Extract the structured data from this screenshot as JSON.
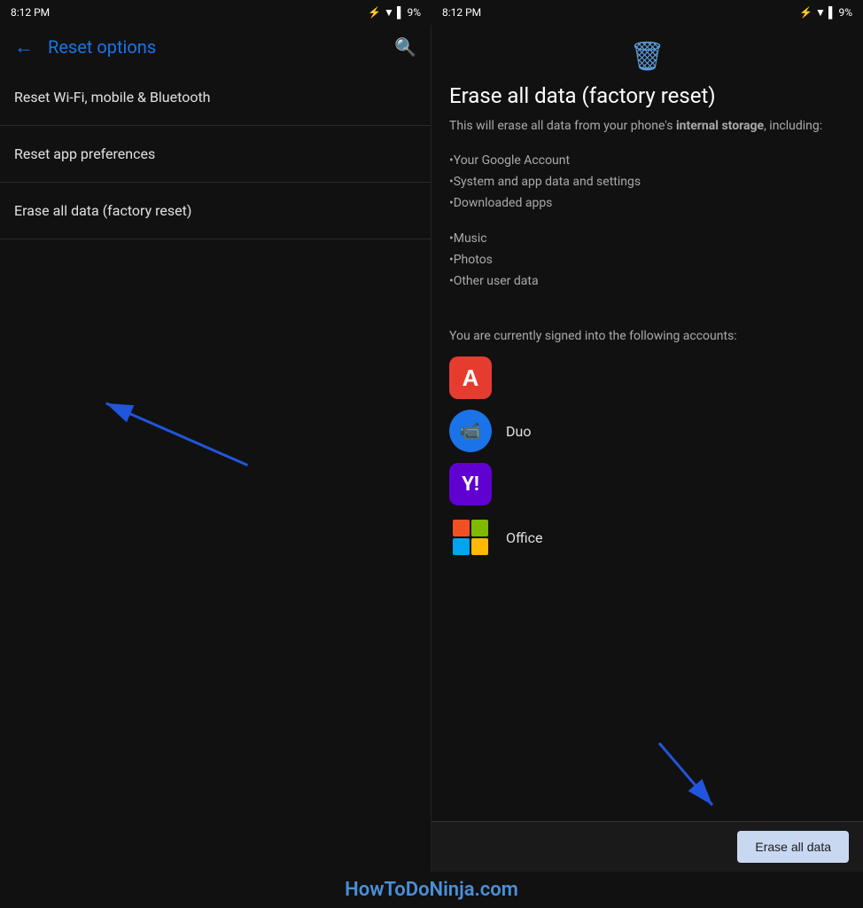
{
  "left": {
    "status": {
      "time": "8:12 PM",
      "battery": "9%"
    },
    "header": {
      "back_label": "←",
      "title": "Reset options",
      "search_label": "🔍"
    },
    "menu_items": [
      {
        "id": "wifi-reset",
        "label": "Reset Wi-Fi, mobile & Bluetooth"
      },
      {
        "id": "app-prefs",
        "label": "Reset app preferences"
      },
      {
        "id": "factory-reset",
        "label": "Erase all data (factory reset)"
      }
    ]
  },
  "right": {
    "status": {
      "time": "8:12 PM",
      "battery": "9%"
    },
    "trash_icon": "🗑",
    "title": "Erase all data (factory reset)",
    "description_prefix": "This will erase all data from your phone's ",
    "description_bold": "internal storage",
    "description_suffix": ", including:",
    "data_items": [
      "•Your Google Account",
      "•System and app data and settings",
      "•Downloaded apps",
      "•Music",
      "•Photos",
      "•Other user data"
    ],
    "signed_in_text": "You are currently signed into the following accounts:",
    "accounts": [
      {
        "id": "adobe",
        "type": "adobe",
        "label": ""
      },
      {
        "id": "duo",
        "type": "duo",
        "label": "Duo"
      },
      {
        "id": "yahoo",
        "type": "yahoo",
        "label": ""
      },
      {
        "id": "office",
        "type": "office",
        "label": "Office"
      }
    ],
    "erase_button_label": "Erase all data"
  },
  "watermark": "HowToDoNinja.com"
}
